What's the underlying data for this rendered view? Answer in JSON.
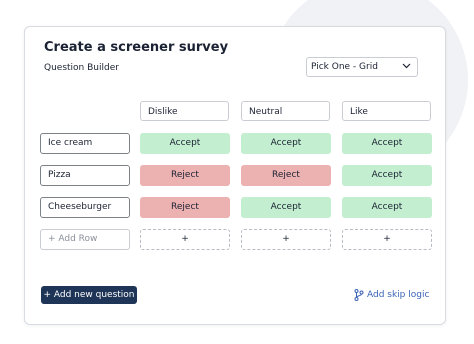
{
  "card": {
    "title": "Create a screener survey",
    "subtitle": "Question Builder"
  },
  "question_type": {
    "selected": "Pick One - Grid",
    "icon": "chevron-down-icon"
  },
  "grid": {
    "columns": [
      "Dislike",
      "Neutral",
      "Like"
    ],
    "rows": [
      {
        "label": "Ice cream",
        "cells": [
          "Accept",
          "Accept",
          "Accept"
        ]
      },
      {
        "label": "Pizza",
        "cells": [
          "Reject",
          "Reject",
          "Accept"
        ]
      },
      {
        "label": "Cheeseburger",
        "cells": [
          "Reject",
          "Accept",
          "Accept"
        ]
      }
    ],
    "add_row_placeholder": "+ Add Row",
    "add_cell_label": "+"
  },
  "actions": {
    "add_question": "+ Add new question",
    "skip_logic": "Add skip logic",
    "skip_logic_icon": "branch-icon"
  },
  "colors": {
    "accept": "#c3efd0",
    "reject": "#ecb1b1",
    "primary": "#1e3557",
    "link": "#3b63b7"
  }
}
